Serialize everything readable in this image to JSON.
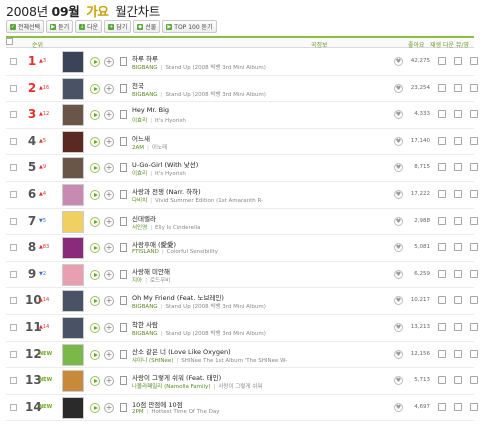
{
  "header": {
    "year": "2008년",
    "month": "09월",
    "genre": "가요",
    "chart_name": "월간차트"
  },
  "toolbar": {
    "select_all": "전체선택",
    "listen": "듣기",
    "download": "다운",
    "add": "담기",
    "gift": "선물",
    "top100": "TOP 100 듣기"
  },
  "columns": {
    "rank": "순위",
    "song_info": "곡정보",
    "likes": "좋아요",
    "actions": "재생 다운 뮤/영"
  },
  "colors": {
    "accent_green": "#8bbf3c",
    "rank_top": "#e0322e",
    "up": "#e0322e",
    "down": "#3b6fd1",
    "new": "#6fa81f"
  },
  "rows": [
    {
      "rank": "1",
      "chg": "▲3",
      "dir": "up",
      "song": "하루 하루",
      "artist": "BIGBANG",
      "album": "Stand Up (2008 빅뱅 3rd Mini Album)",
      "likes": "42,275",
      "art": "#3a4456"
    },
    {
      "rank": "2",
      "chg": "▲16",
      "dir": "up",
      "song": "천국",
      "artist": "BIGBANG",
      "album": "Stand Up (2008 빅뱅 3rd Mini Album)",
      "likes": "23,254",
      "art": "#4a5266"
    },
    {
      "rank": "3",
      "chg": "▲12",
      "dir": "up",
      "song": "Hey Mr. Big",
      "artist": "이효리",
      "album": "It's Hyorish",
      "likes": "4,333",
      "art": "#6a5648"
    },
    {
      "rank": "4",
      "chg": "▲5",
      "dir": "up",
      "song": "어느새",
      "artist": "2AM",
      "album": "이노래",
      "likes": "17,140",
      "art": "#5a2a22"
    },
    {
      "rank": "5",
      "chg": "▲9",
      "dir": "up",
      "song": "U-Go-Girl (With 낯선)",
      "artist": "이효리",
      "album": "It's Hyorish",
      "likes": "8,715",
      "art": "#6a5648"
    },
    {
      "rank": "6",
      "chg": "▲4",
      "dir": "up",
      "song": "사랑과 전쟁 (Narr. 하하)",
      "artist": "다비치",
      "album": "Vivid Summer Edition (1st Amaranth R-",
      "likes": "17,222",
      "art": "#c88ab0"
    },
    {
      "rank": "7",
      "chg": "▼5",
      "dir": "dn",
      "song": "신데렐라",
      "artist": "서인영",
      "album": "Elly Is Cinderella",
      "likes": "2,988",
      "art": "#f0d060"
    },
    {
      "rank": "8",
      "chg": "▲83",
      "dir": "up",
      "song": "사랑후애 (愛愛)",
      "artist": "FTISLAND",
      "album": "Colorful Sensibility",
      "likes": "5,081",
      "art": "#8a2a7a"
    },
    {
      "rank": "9",
      "chg": "▼2",
      "dir": "dn",
      "song": "사랑해 미안해",
      "artist": "지아",
      "album": "로드무비",
      "likes": "6,259",
      "art": "#e8a0b0"
    },
    {
      "rank": "10",
      "chg": "▲14",
      "dir": "up",
      "song": "Oh My Friend (Feat. 노브레인)",
      "artist": "BIGBANG",
      "album": "Stand Up (2008 빅뱅 3rd Mini Album)",
      "likes": "10,217",
      "art": "#4a5266"
    },
    {
      "rank": "11",
      "chg": "▲14",
      "dir": "up",
      "song": "착한 사람",
      "artist": "BIGBANG",
      "album": "Stand Up (2008 빅뱅 3rd Mini Album)",
      "likes": "13,213",
      "art": "#4a5266"
    },
    {
      "rank": "12",
      "chg": "NEW",
      "dir": "new",
      "song": "산소 같은 너 (Love Like Oxygen)",
      "artist": "샤이니 (SHINee)",
      "album": "SHINee The 1st Album 'The SHINee W-",
      "likes": "12,156",
      "art": "#7ab84a"
    },
    {
      "rank": "13",
      "chg": "NEW",
      "dir": "new",
      "song": "사랑이 그렇게 쉬워 (Feat. 태인)",
      "artist": "나몰라패밀리 (Namolla Family)",
      "album": "사랑이 그렇게 쉬워",
      "likes": "5,713",
      "art": "#c88a3a"
    },
    {
      "rank": "14",
      "chg": "NEW",
      "dir": "new",
      "song": "10점 만점에 10점",
      "artist": "2PM",
      "album": "Hottest Time Of The Day",
      "likes": "4,697",
      "art": "#2a2a2a"
    }
  ]
}
